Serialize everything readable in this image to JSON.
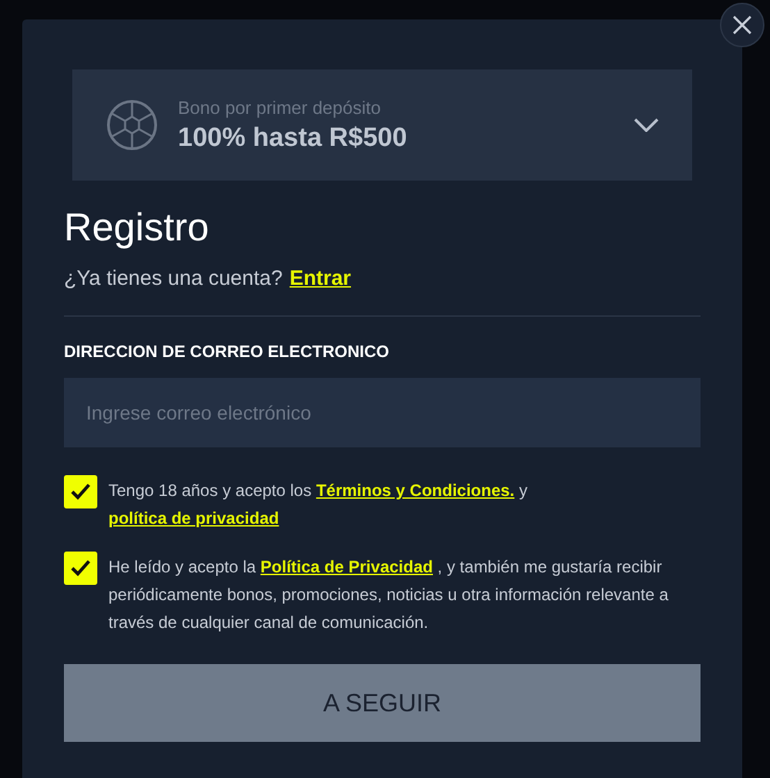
{
  "bonus": {
    "caption": "Bono por primer depósito",
    "offer": "100% hasta R$500",
    "expanded": false
  },
  "title": "Registro",
  "login_prompt": {
    "text": "¿Ya tienes una cuenta?",
    "link": "Entrar"
  },
  "email": {
    "label": "DIRECCION DE CORREO ELECTRONICO",
    "placeholder": "Ingrese correo electrónico"
  },
  "consents": [
    {
      "checked": true,
      "parts": [
        {
          "kind": "text",
          "text": "Tengo 18 años y acepto los "
        },
        {
          "kind": "link",
          "text": "Términos y Condiciones."
        },
        {
          "kind": "text",
          "text": " y "
        },
        {
          "kind": "link",
          "text": "política de privacidad"
        }
      ]
    },
    {
      "checked": true,
      "parts": [
        {
          "kind": "text",
          "text": "He leído y acepto la "
        },
        {
          "kind": "link",
          "text": "Política de Privacidad"
        },
        {
          "kind": "text",
          "text": " , y también me gustaría recibir periódicamente bonos, promociones, noticias u otra información relevante a través de cualquier canal de comunicación."
        }
      ]
    }
  ],
  "submit": {
    "label": "A SEGUIR",
    "disabled": true
  }
}
